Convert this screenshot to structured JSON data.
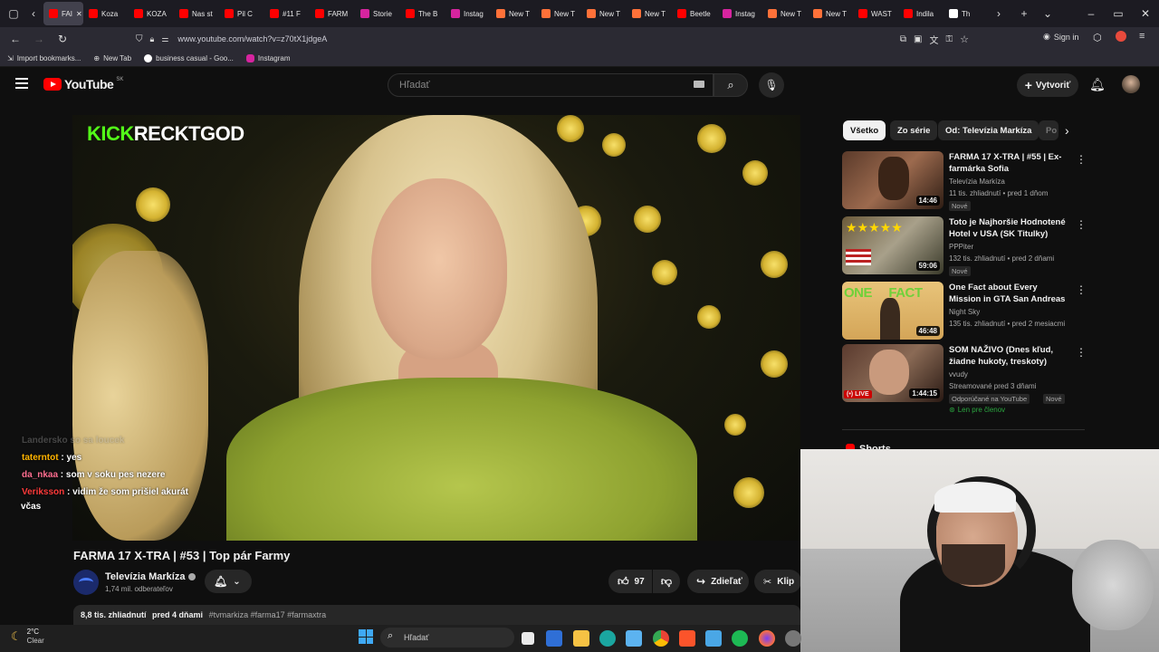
{
  "browser": {
    "tabs": [
      {
        "label": "FAI",
        "color": "#ff0000"
      },
      {
        "label": "Koza",
        "color": "#ff0000"
      },
      {
        "label": "KOZA",
        "color": "#ff0000"
      },
      {
        "label": "Nas st",
        "color": "#ff0000"
      },
      {
        "label": "Pil C",
        "color": "#ff0000"
      },
      {
        "label": "#11 F",
        "color": "#ff0000"
      },
      {
        "label": "FARM",
        "color": "#ff0000"
      },
      {
        "label": "Storie",
        "color": "#d6249f"
      },
      {
        "label": "The B",
        "color": "#ff0000"
      },
      {
        "label": "Instag",
        "color": "#d6249f"
      },
      {
        "label": "New T",
        "color": "#ff7139"
      },
      {
        "label": "New T",
        "color": "#ff7139"
      },
      {
        "label": "New T",
        "color": "#ff7139"
      },
      {
        "label": "New T",
        "color": "#ff7139"
      },
      {
        "label": "Beetle",
        "color": "#ff0000"
      },
      {
        "label": "Instag",
        "color": "#d6249f"
      },
      {
        "label": "New T",
        "color": "#ff7139"
      },
      {
        "label": "New T",
        "color": "#ff7139"
      },
      {
        "label": "WAST",
        "color": "#ff0000"
      },
      {
        "label": "Indila",
        "color": "#ff0000"
      },
      {
        "label": "Th",
        "color": "#ffffff"
      }
    ],
    "url": "www.youtube.com/watch?v=z70tX1jdgeA",
    "sign_in": "Sign in",
    "bookmarks": [
      "Import bookmarks...",
      "New Tab",
      "business casual - Goo...",
      "Instagram"
    ]
  },
  "youtube": {
    "logo": "YouTube",
    "region": "SK",
    "search_placeholder": "Hľadať",
    "create_label": "Vytvoriť",
    "colors": {
      "accent": "#ff0000",
      "bg": "#0f0f0f"
    }
  },
  "video": {
    "overlay_brand": "KICK",
    "overlay_name": "RECKTGOD",
    "title": "FARMA 17 X-TRA | #53 | Top pár Farmy",
    "channel": "Televízia Markíza",
    "subscribers": "1,74 mil. odberateľov",
    "likes": "97",
    "share_label": "Zdieľať",
    "clip_label": "Klip",
    "views": "8,8 tis. zhliadnutí",
    "age": "pred 4 dňami",
    "tags": "#tvmarkiza #farma17 #farmaxtra"
  },
  "chat": [
    {
      "user": "Landersko",
      "text": "so sa loucek",
      "color": "#555555"
    },
    {
      "user": "taterntot",
      "text": "yes",
      "color": "#ffb400"
    },
    {
      "user": "da_nkaa",
      "text": "som v soku pes nezere",
      "color": "#ff6f91"
    },
    {
      "user": "Veriksson",
      "text": "vidim že som prišiel akurát",
      "color": "#ff3b3b"
    },
    {
      "user": "",
      "text": "včas",
      "color": "#ffffff"
    }
  ],
  "sidebar": {
    "chips": [
      "Všetko",
      "Zo série",
      "Od: Televízia Markíza",
      "Po"
    ],
    "recs": [
      {
        "title": "FARMA 17 X-TRA | #55 | Ex-farmárka Sofia",
        "channel": "Televízia Markíza",
        "meta": "11 tis. zhliadnutí • pred 1 dňom",
        "badge": "Nové",
        "duration": "14:46"
      },
      {
        "title": "Toto je Najhoršie Hodnotené Hotel v USA (SK Titulky)",
        "channel": "PPPiter",
        "meta": "132 tis. zhliadnutí • pred 2 dňami",
        "badge": "Nové",
        "duration": "59:06"
      },
      {
        "title": "One Fact about Every Mission in GTA San Andreas",
        "channel": "Night Sky",
        "meta": "135 tis. zhliadnutí • pred 2 mesiacmi",
        "badge": "",
        "duration": "46:48"
      },
      {
        "title": "SOM NAŽIVO (Dnes kľud, žiadne hukoty, treskoty)",
        "channel": "vvudy",
        "meta": "Streamované pred 3 dňami",
        "badge": "Odporúčané na YouTube",
        "badge2": "Nové",
        "members": "Len pre členov",
        "duration": "1:44:15",
        "live": "LIVE"
      }
    ],
    "shorts_label": "Shorts"
  },
  "taskbar": {
    "weather_temp": "2°C",
    "weather_desc": "Clear",
    "search_label": "Hľadať"
  }
}
